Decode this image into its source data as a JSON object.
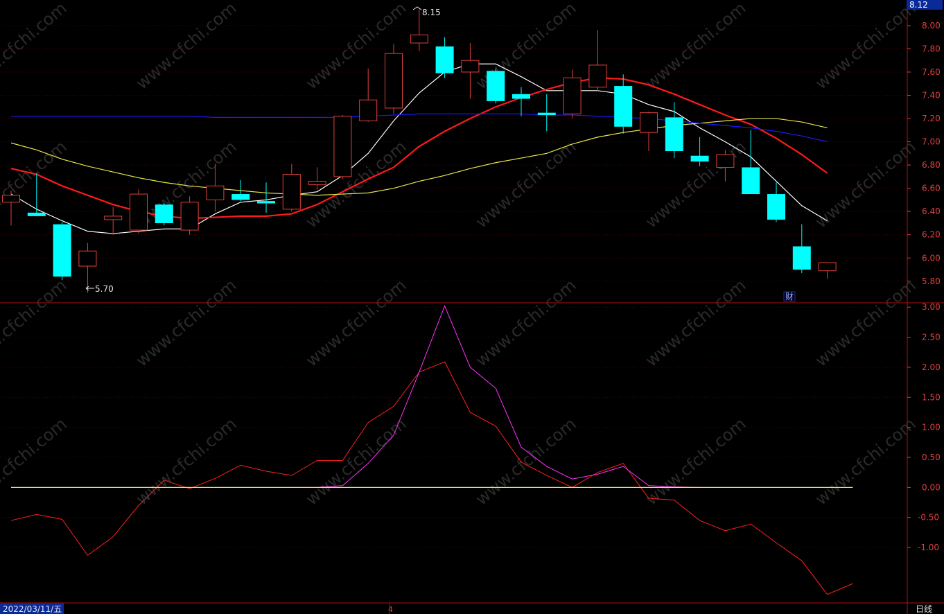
{
  "chart_data": [
    {
      "type": "candlestick",
      "ylim": [
        5.62,
        8.22
      ],
      "yticks": [
        5.8,
        6.0,
        6.2,
        6.4,
        6.6,
        6.8,
        7.0,
        7.2,
        7.4,
        7.6,
        7.8,
        8.0
      ],
      "current_price": "8.12",
      "high_label": "8.15",
      "low_label": "5.70",
      "fin_marker": "财",
      "colors": {
        "up": "#e0413a",
        "down": "#00ffff",
        "grid": "#5a0000"
      },
      "candles": [
        {
          "o": 6.48,
          "h": 6.58,
          "l": 6.28,
          "c": 6.54
        },
        {
          "o": 6.39,
          "h": 6.73,
          "l": 6.36,
          "c": 6.36
        },
        {
          "o": 6.29,
          "h": 6.31,
          "l": 5.81,
          "c": 5.84
        },
        {
          "o": 5.93,
          "h": 6.13,
          "l": 5.7,
          "c": 6.06
        },
        {
          "o": 6.33,
          "h": 6.44,
          "l": 6.2,
          "c": 6.36
        },
        {
          "o": 6.24,
          "h": 6.59,
          "l": 6.21,
          "c": 6.55
        },
        {
          "o": 6.46,
          "h": 6.47,
          "l": 6.28,
          "c": 6.3
        },
        {
          "o": 6.24,
          "h": 6.53,
          "l": 6.2,
          "c": 6.48
        },
        {
          "o": 6.5,
          "h": 6.81,
          "l": 6.4,
          "c": 6.62
        },
        {
          "o": 6.55,
          "h": 6.67,
          "l": 6.49,
          "c": 6.5
        },
        {
          "o": 6.49,
          "h": 6.65,
          "l": 6.39,
          "c": 6.47
        },
        {
          "o": 6.42,
          "h": 6.81,
          "l": 6.4,
          "c": 6.72
        },
        {
          "o": 6.63,
          "h": 6.78,
          "l": 6.59,
          "c": 6.66
        },
        {
          "o": 6.7,
          "h": 7.23,
          "l": 6.68,
          "c": 7.22
        },
        {
          "o": 7.18,
          "h": 7.63,
          "l": 7.17,
          "c": 7.36
        },
        {
          "o": 7.29,
          "h": 7.84,
          "l": 7.24,
          "c": 7.76
        },
        {
          "o": 7.85,
          "h": 8.15,
          "l": 7.78,
          "c": 7.92
        },
        {
          "o": 7.82,
          "h": 7.9,
          "l": 7.55,
          "c": 7.59
        },
        {
          "o": 7.6,
          "h": 7.85,
          "l": 7.37,
          "c": 7.7
        },
        {
          "o": 7.61,
          "h": 7.63,
          "l": 7.33,
          "c": 7.35
        },
        {
          "o": 7.41,
          "h": 7.47,
          "l": 7.22,
          "c": 7.37
        },
        {
          "o": 7.25,
          "h": 7.41,
          "l": 7.09,
          "c": 7.23
        },
        {
          "o": 7.24,
          "h": 7.62,
          "l": 7.2,
          "c": 7.55
        },
        {
          "o": 7.47,
          "h": 7.96,
          "l": 7.44,
          "c": 7.66
        },
        {
          "o": 7.48,
          "h": 7.58,
          "l": 7.07,
          "c": 7.13
        },
        {
          "o": 7.08,
          "h": 7.26,
          "l": 6.92,
          "c": 7.25
        },
        {
          "o": 7.21,
          "h": 7.34,
          "l": 6.86,
          "c": 6.92
        },
        {
          "o": 6.88,
          "h": 7.04,
          "l": 6.79,
          "c": 6.83
        },
        {
          "o": 6.78,
          "h": 6.93,
          "l": 6.66,
          "c": 6.89
        },
        {
          "o": 6.78,
          "h": 7.1,
          "l": 6.55,
          "c": 6.55
        },
        {
          "o": 6.55,
          "h": 6.65,
          "l": 6.31,
          "c": 6.33
        },
        {
          "o": 6.1,
          "h": 6.29,
          "l": 5.87,
          "c": 5.9
        },
        {
          "o": 5.89,
          "h": 5.96,
          "l": 5.82,
          "c": 5.96
        }
      ],
      "ma_lines": [
        {
          "color": "#ffffff",
          "width": 1.2,
          "values": [
            6.55,
            6.42,
            6.32,
            6.23,
            6.21,
            6.23,
            6.25,
            6.25,
            6.38,
            6.48,
            6.5,
            6.54,
            6.57,
            6.71,
            6.9,
            7.18,
            7.42,
            7.6,
            7.67,
            7.67,
            7.56,
            7.44,
            7.44,
            7.44,
            7.41,
            7.32,
            7.26,
            7.12,
            7.0,
            6.87,
            6.66,
            6.45,
            6.32
          ]
        },
        {
          "color": "#ff1a1a",
          "width": 2.2,
          "values": [
            6.77,
            6.72,
            6.62,
            6.54,
            6.46,
            6.4,
            6.36,
            6.34,
            6.35,
            6.36,
            6.36,
            6.38,
            6.46,
            6.57,
            6.68,
            6.78,
            6.96,
            7.09,
            7.2,
            7.3,
            7.38,
            7.45,
            7.51,
            7.55,
            7.54,
            7.49,
            7.41,
            7.32,
            7.23,
            7.15,
            7.03,
            6.89,
            6.73
          ]
        },
        {
          "color": "#e8e84a",
          "width": 1.2,
          "values": [
            6.99,
            6.93,
            6.85,
            6.79,
            6.74,
            6.69,
            6.65,
            6.62,
            6.6,
            6.58,
            6.56,
            6.55,
            6.54,
            6.55,
            6.56,
            6.6,
            6.66,
            6.71,
            6.77,
            6.82,
            6.86,
            6.9,
            6.98,
            7.04,
            7.08,
            7.11,
            7.14,
            7.16,
            7.18,
            7.2,
            7.2,
            7.17,
            7.12
          ]
        },
        {
          "color": "#1a1aff",
          "width": 1.2,
          "values": [
            7.22,
            7.22,
            7.22,
            7.22,
            7.22,
            7.22,
            7.22,
            7.22,
            7.21,
            7.21,
            7.21,
            7.21,
            7.21,
            7.21,
            7.22,
            7.23,
            7.24,
            7.24,
            7.24,
            7.24,
            7.24,
            7.23,
            7.23,
            7.22,
            7.21,
            7.2,
            7.18,
            7.16,
            7.14,
            7.12,
            7.09,
            7.05,
            7.0
          ]
        }
      ]
    },
    {
      "type": "line",
      "ylim": [
        -1.91,
        3.06
      ],
      "yticks": [
        -1.0,
        -0.5,
        0.0,
        0.5,
        1.0,
        1.5,
        2.0,
        2.5,
        3.0
      ],
      "series": [
        {
          "color": "#ff2020",
          "values": [
            -0.55,
            -0.45,
            -0.53,
            -1.13,
            -0.82,
            -0.3,
            0.12,
            -0.02,
            0.15,
            0.37,
            0.27,
            0.2,
            0.45,
            0.45,
            1.08,
            1.35,
            1.92,
            2.09,
            1.25,
            1.02,
            0.42,
            0.2,
            0.0,
            0.25,
            0.4,
            -0.18,
            -0.21,
            -0.55,
            -0.72,
            -0.61,
            -0.92,
            -1.22,
            -1.78,
            -1.6
          ]
        },
        {
          "color": "#ff33ff",
          "start": 11,
          "values": [
            0.0,
            0.0,
            0.03,
            0.4,
            0.87,
            1.92,
            3.02,
            2.0,
            1.65,
            0.67,
            0.35,
            0.14,
            0.22,
            0.35,
            0.03,
            0.01,
            0.0
          ]
        },
        {
          "color": "#e8e84a",
          "values": [
            0,
            0,
            0,
            0,
            0,
            0,
            0,
            0,
            0,
            0,
            0,
            0,
            0,
            0,
            0,
            0,
            0,
            0,
            0,
            0,
            0,
            0,
            0,
            0,
            0,
            0,
            0,
            0,
            0,
            0,
            0,
            0,
            0,
            0
          ]
        }
      ]
    }
  ],
  "footer": {
    "date": "2022/03/11/五",
    "marker": "4",
    "period": "日线"
  },
  "watermark": "www.cfchi.com"
}
